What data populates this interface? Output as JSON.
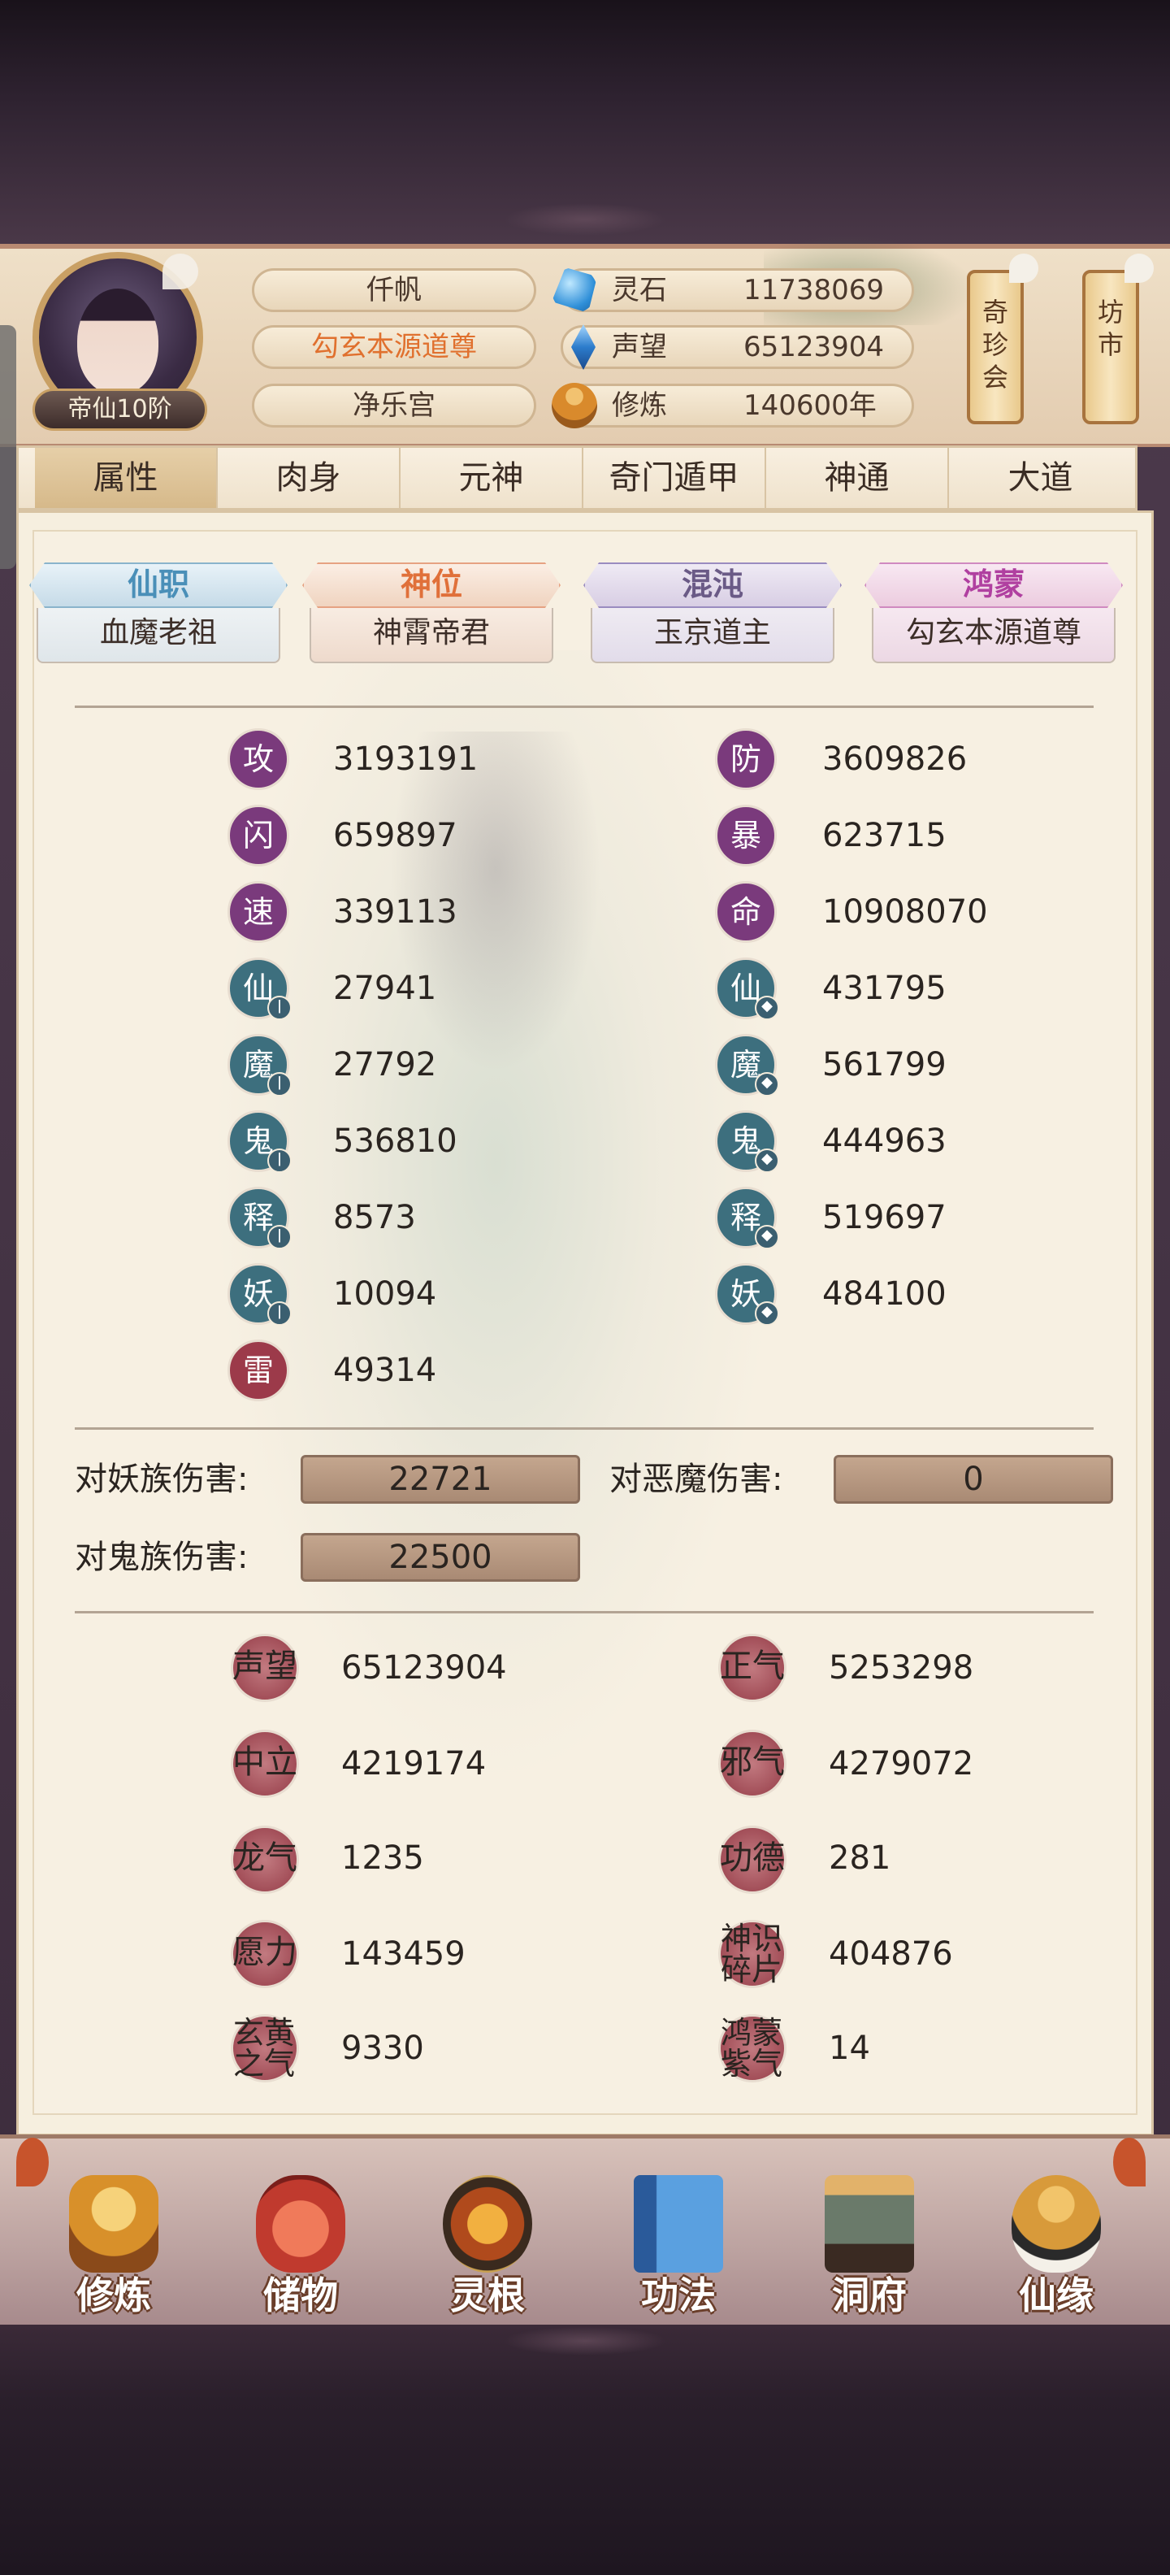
{
  "player": {
    "name": "仟帆",
    "title": "勾玄本源道尊",
    "sect": "净乐宫",
    "rank": "帝仙10阶"
  },
  "resources": [
    {
      "name": "灵石",
      "value": "11738069",
      "icon": "spirit-stone-icon"
    },
    {
      "name": "声望",
      "value": "65123904",
      "icon": "prestige-crystal-icon"
    },
    {
      "name": "修炼",
      "value": "140600年",
      "icon": "meditation-icon"
    }
  ],
  "side_buttons": [
    {
      "label": "奇珍会"
    },
    {
      "label": "坊市"
    }
  ],
  "tabs": [
    "属性",
    "肉身",
    "元神",
    "奇门遁甲",
    "神通",
    "大道"
  ],
  "active_tab": "属性",
  "titles": [
    {
      "header": "仙职",
      "value": "血魔老祖",
      "color": "#4a8fb8"
    },
    {
      "header": "神位",
      "value": "神霄帝君",
      "color": "#e0703a"
    },
    {
      "header": "混沌",
      "value": "玉京道主",
      "color": "#6a5a86"
    },
    {
      "header": "鸿蒙",
      "value": "勾玄本源道尊",
      "color": "#b040a0"
    }
  ],
  "attributes_left": [
    {
      "label": "攻",
      "value": "3193191",
      "badge": ""
    },
    {
      "label": "闪",
      "value": "659897",
      "badge": ""
    },
    {
      "label": "速",
      "value": "339113",
      "badge": ""
    },
    {
      "label": "仙",
      "value": "27941",
      "badge": "sword"
    },
    {
      "label": "魔",
      "value": "27792",
      "badge": "sword"
    },
    {
      "label": "鬼",
      "value": "536810",
      "badge": "sword"
    },
    {
      "label": "释",
      "value": "8573",
      "badge": "sword"
    },
    {
      "label": "妖",
      "value": "10094",
      "badge": "sword"
    },
    {
      "label": "雷",
      "value": "49314",
      "badge": ""
    }
  ],
  "attributes_right": [
    {
      "label": "防",
      "value": "3609826",
      "badge": ""
    },
    {
      "label": "暴",
      "value": "623715",
      "badge": ""
    },
    {
      "label": "命",
      "value": "10908070",
      "badge": ""
    },
    {
      "label": "仙",
      "value": "431795",
      "badge": "shield"
    },
    {
      "label": "魔",
      "value": "561799",
      "badge": "shield"
    },
    {
      "label": "鬼",
      "value": "444963",
      "badge": "shield"
    },
    {
      "label": "释",
      "value": "519697",
      "badge": "shield"
    },
    {
      "label": "妖",
      "value": "484100",
      "badge": "shield"
    }
  ],
  "damage": [
    {
      "label": "对妖族伤害:",
      "value": "22721"
    },
    {
      "label": "对恶魔伤害:",
      "value": "0"
    },
    {
      "label": "对鬼族伤害:",
      "value": "22500"
    }
  ],
  "misc_left": [
    {
      "label": "声望",
      "value": "65123904"
    },
    {
      "label": "中立",
      "value": "4219174"
    },
    {
      "label": "龙气",
      "value": "1235"
    },
    {
      "label": "愿力",
      "value": "143459"
    },
    {
      "label": "玄黄之气",
      "value": "9330"
    }
  ],
  "misc_right": [
    {
      "label": "正气",
      "value": "5253298"
    },
    {
      "label": "邪气",
      "value": "4279072"
    },
    {
      "label": "功德",
      "value": "281"
    },
    {
      "label": "神识碎片",
      "value": "404876"
    },
    {
      "label": "鸿蒙紫气",
      "value": "14"
    }
  ],
  "nav": [
    {
      "label": "修炼",
      "icon": "cultivate-icon"
    },
    {
      "label": "储物",
      "icon": "storage-bag-icon"
    },
    {
      "label": "灵根",
      "icon": "spirit-root-icon"
    },
    {
      "label": "功法",
      "icon": "technique-book-icon"
    },
    {
      "label": "洞府",
      "icon": "cave-abode-icon"
    },
    {
      "label": "仙缘",
      "icon": "fate-gourd-icon"
    }
  ],
  "colors": {
    "attr_purple": "#7a3a7c",
    "attr_teal": "#3d6f7e",
    "attr_red": "#9c3a4a",
    "misc_red": "#a24e58"
  }
}
